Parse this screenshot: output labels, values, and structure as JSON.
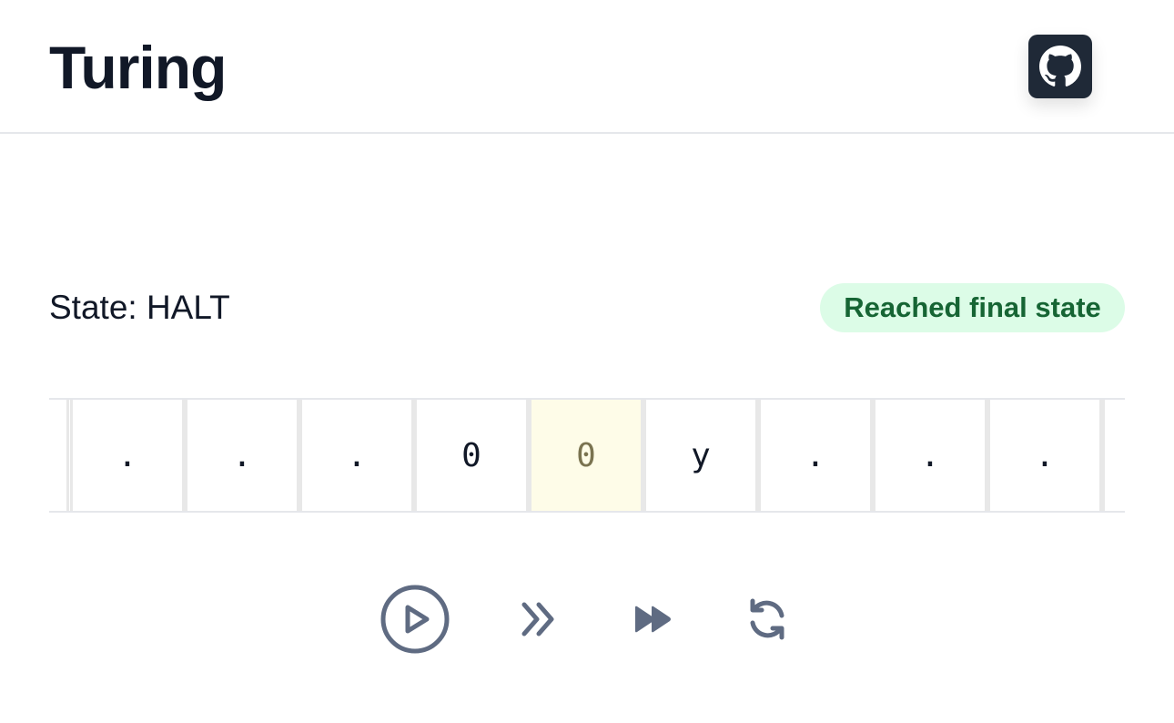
{
  "app": {
    "title": "Turing"
  },
  "header": {
    "github_icon": "github-icon"
  },
  "status": {
    "state_label": "State: HALT",
    "badge_text": "Reached final state",
    "badge_bg": "#dcfce7",
    "badge_fg": "#166534"
  },
  "tape": {
    "cells": [
      ".",
      ".",
      ".",
      "0",
      "0",
      "y",
      ".",
      ".",
      "."
    ],
    "head_index": 4,
    "head_color": "#fefce8"
  },
  "controls": {
    "icons": [
      "play-circle-icon",
      "step-forward-icon",
      "fast-forward-icon",
      "reset-icon"
    ],
    "icon_color": "#5f6b82"
  }
}
